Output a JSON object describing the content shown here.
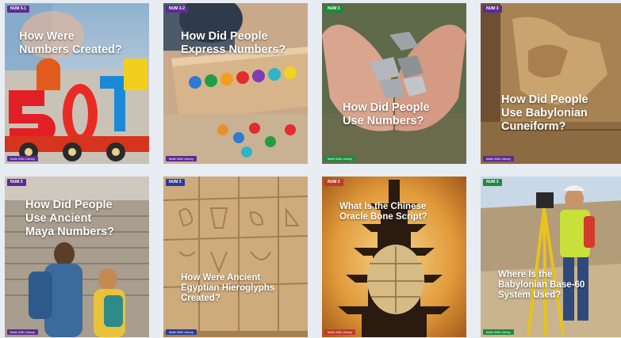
{
  "cards": [
    {
      "level": "NUM 3-1",
      "title": "How Were\nNumbers Created?",
      "footer": "Math Wiki Library",
      "badge_color": "#5b2d91",
      "footer_color": "#5b2d91"
    },
    {
      "level": "NUM 3-2",
      "title": "How Did People\nExpress Numbers?",
      "footer": "Math Wiki Library",
      "badge_color": "#5b2d91",
      "footer_color": "#5b2d91"
    },
    {
      "level": "NUM 3",
      "title": "How Did People\nUse Numbers?",
      "footer": "Math Wiki Library",
      "badge_color": "#1e8a3c",
      "footer_color": "#1e8a3c"
    },
    {
      "level": "NUM 3",
      "title": "How Did People\nUse Babylonian\nCuneiform?",
      "footer": "Math Wiki Library",
      "badge_color": "#5b2d91",
      "footer_color": "#5b2d91"
    },
    {
      "level": "NUM 3",
      "title": "How Did People\nUse Ancient\nMaya Numbers?",
      "footer": "Math Wiki Library",
      "badge_color": "#5b2d91",
      "footer_color": "#5b2d91"
    },
    {
      "level": "NUM 3",
      "title": "How Were Ancient\nEgyptian Hieroglyphs\nCreated?",
      "footer": "Math Wiki Library",
      "badge_color": "#2a3d9c",
      "footer_color": "#2a3d9c"
    },
    {
      "level": "NUM 3",
      "title": "What Is the Chinese\nOracle Bone Script?",
      "footer": "Math Wiki Library",
      "badge_color": "#c0392b",
      "footer_color": "#c0392b"
    },
    {
      "level": "NUM 3",
      "title": "Where Is the\nBabylonian Base-60\nSystem Used?",
      "footer": "Math Wiki Library",
      "badge_color": "#1e8a3c",
      "footer_color": "#1e8a3c"
    }
  ]
}
